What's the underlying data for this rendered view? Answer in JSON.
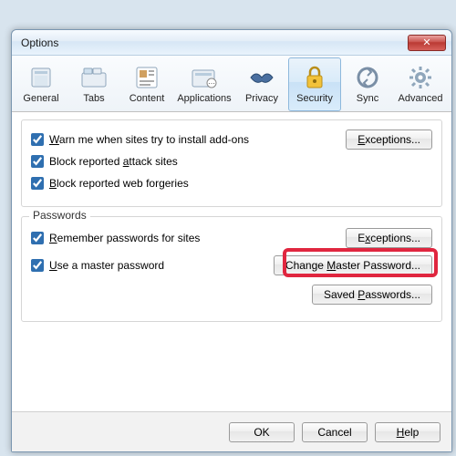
{
  "window": {
    "title": "Options"
  },
  "tabs": [
    {
      "label": "General",
      "icon": "general-icon"
    },
    {
      "label": "Tabs",
      "icon": "tabs-icon"
    },
    {
      "label": "Content",
      "icon": "content-icon"
    },
    {
      "label": "Applications",
      "icon": "applications-icon"
    },
    {
      "label": "Privacy",
      "icon": "privacy-icon"
    },
    {
      "label": "Security",
      "icon": "security-icon",
      "selected": true
    },
    {
      "label": "Sync",
      "icon": "sync-icon"
    },
    {
      "label": "Advanced",
      "icon": "advanced-icon"
    }
  ],
  "security": {
    "warn_addons": {
      "checked": true,
      "pre": "",
      "acc": "W",
      "post": "arn me when sites try to install add-ons"
    },
    "block_attack": {
      "checked": true,
      "pre": "Block reported ",
      "acc": "a",
      "post": "ttack sites"
    },
    "block_forgery": {
      "checked": true,
      "pre": "",
      "acc": "B",
      "post": "lock reported web forgeries"
    },
    "exceptions_btn": {
      "pre": "",
      "acc": "E",
      "post": "xceptions..."
    }
  },
  "passwords": {
    "group_label": "Passwords",
    "remember": {
      "checked": true,
      "pre": "",
      "acc": "R",
      "post": "emember passwords for sites"
    },
    "use_master": {
      "checked": true,
      "pre": "",
      "acc": "U",
      "post": "se a master password"
    },
    "exceptions_btn": {
      "pre": "E",
      "acc": "x",
      "post": "ceptions..."
    },
    "change_master_btn": {
      "pre": "Change ",
      "acc": "M",
      "post": "aster Password..."
    },
    "saved_btn": {
      "pre": "Saved ",
      "acc": "P",
      "post": "asswords..."
    }
  },
  "buttons": {
    "ok": "OK",
    "cancel": "Cancel",
    "help": {
      "pre": "",
      "acc": "H",
      "post": "elp"
    }
  }
}
